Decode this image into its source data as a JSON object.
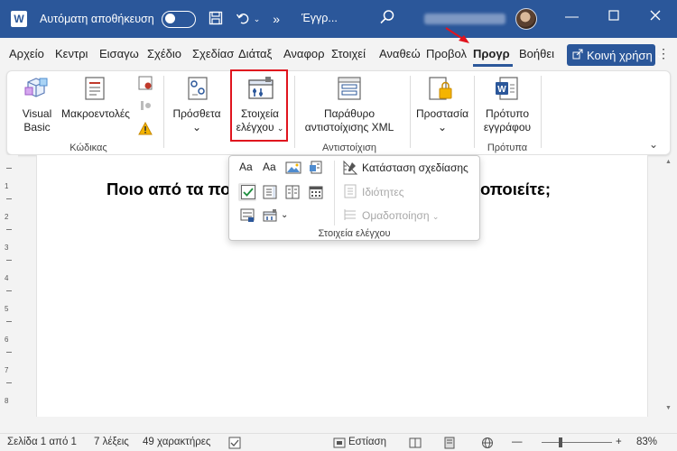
{
  "titlebar": {
    "app_letter": "W",
    "autosave_label": "Αυτόματη αποθήκευση",
    "doc_title": "Έγγρ...",
    "icons": [
      "save-icon",
      "undo-icon",
      "search-icon",
      "minimize-icon",
      "maximize-icon",
      "close-icon"
    ]
  },
  "tabs": [
    {
      "label": "Αρχείο"
    },
    {
      "label": "Κεντρι"
    },
    {
      "label": "Εισαγω"
    },
    {
      "label": "Σχέδιο"
    },
    {
      "label": "Σχεδίασ"
    },
    {
      "label": "Διάταξ"
    },
    {
      "label": "Αναφορ"
    },
    {
      "label": "Στοιχεί"
    },
    {
      "label": "Αναθεώ"
    },
    {
      "label": "Προβολ"
    },
    {
      "label": "Προγρ",
      "active": true
    },
    {
      "label": "Βοήθει"
    }
  ],
  "share_label": "Κοινή χρήση",
  "ribbon": {
    "visual_basic": "Visual Basic",
    "macros": "Μακροεντολές",
    "code_group": "Κώδικας",
    "addins": "Πρόσθετα",
    "controls": "Στοιχεία ελέγχου",
    "xml_pane": "Παράθυρο αντιστοίχισης XML",
    "mapping_group": "Αντιστοίχιση",
    "protection": "Προστασία",
    "template": "Πρότυπο εγγράφου",
    "templates_group": "Πρότυπα"
  },
  "panel": {
    "design_mode": "Κατάσταση σχεδίασης",
    "properties": "Ιδιότητες",
    "grouping": "Ομαδοποίηση",
    "footer": "Στοιχεία ελέγχου"
  },
  "document": {
    "heading_left": "Ποιο από τα πο",
    "heading_right": "οποιείτε;"
  },
  "status": {
    "page": "Σελίδα 1 από 1",
    "words": "7 λέξεις",
    "chars": "49 χαρακτήρες",
    "focus": "Εστίαση",
    "zoom": "83%"
  },
  "colors": {
    "brand": "#2b579a",
    "highlight": "#e0141e"
  }
}
